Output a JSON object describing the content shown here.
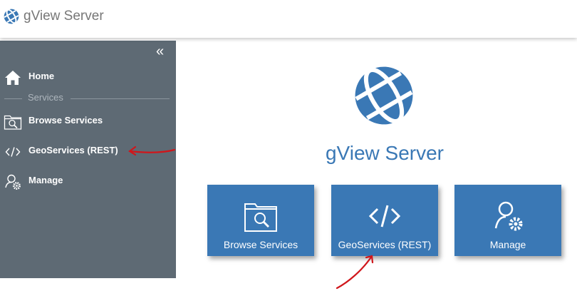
{
  "header": {
    "title": "gView Server"
  },
  "sidebar": {
    "collapse_glyph": "«",
    "items": [
      {
        "label": "Home",
        "icon": "home-icon"
      },
      {
        "label": "Browse Services",
        "icon": "folder-search-icon"
      },
      {
        "label": "GeoServices (REST)",
        "icon": "code-icon"
      },
      {
        "label": "Manage",
        "icon": "user-gear-icon"
      }
    ],
    "section_label": "Services"
  },
  "main": {
    "title": "gView Server",
    "tiles": [
      {
        "label": "Browse Services",
        "icon": "folder-search-icon"
      },
      {
        "label": "GeoServices (REST)",
        "icon": "code-icon"
      },
      {
        "label": "Manage",
        "icon": "user-gear-icon"
      }
    ]
  },
  "colors": {
    "brand_blue": "#3a78b5",
    "sidebar_bg": "#5e6a74",
    "annotation_red": "#d0161b"
  }
}
